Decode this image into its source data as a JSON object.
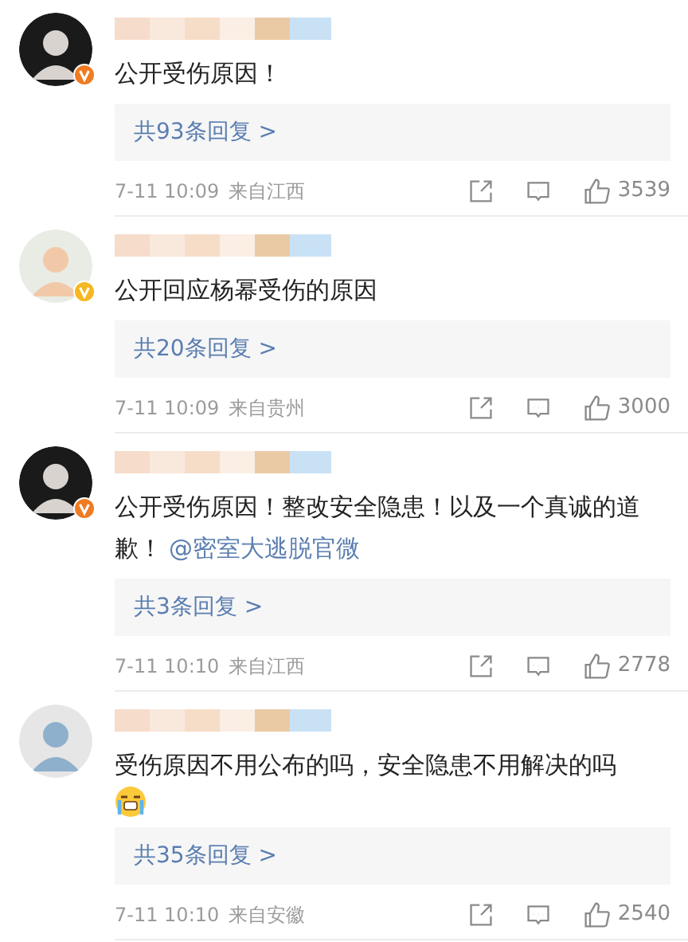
{
  "comments": [
    {
      "text": "公开受伤原因！",
      "emoji": false,
      "color": "#f07b22",
      "replies": "共93条回复 >",
      "time": "7-11 10:09",
      "location": "来自江西",
      "likes": "3539"
    },
    {
      "text": "公开回应杨幂受伤的原因",
      "emoji": false,
      "color": "#f5b820",
      "replies": "共20条回复 >",
      "time": "7-11 10:09",
      "location": "来自贵州",
      "likes": "3000"
    },
    {
      "text": "公开受伤原因！整改安全隐患！以及一个真诚的道歉！",
      "mention": "@密室大逃脱官微",
      "emoji": false,
      "color": "#f07b22",
      "replies": "共3条回复 >",
      "time": "7-11 10:10",
      "location": "来自江西",
      "likes": "2778"
    },
    {
      "text": "受伤原因不用公布的吗，安全隐患不用解决的吗",
      "emoji": true,
      "replies": "共35条回复 >",
      "time": "7-11 10:10",
      "location": "来自安徽",
      "likes": "2540"
    }
  ]
}
